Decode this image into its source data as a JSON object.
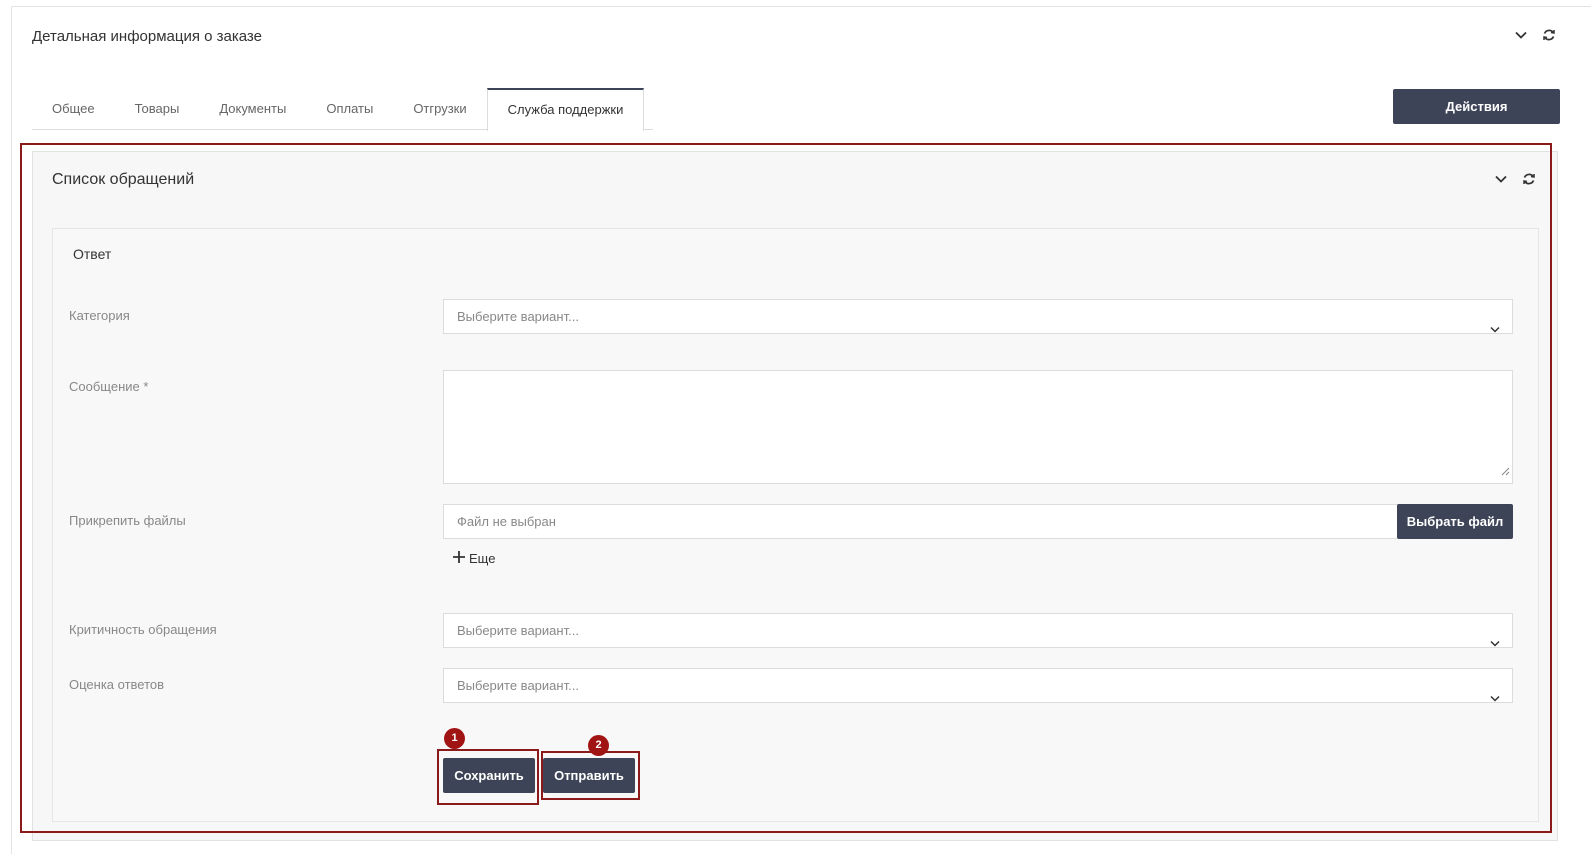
{
  "header": {
    "title": "Детальная информация о заказе",
    "icons": [
      "chevron-down-icon",
      "refresh-icon"
    ]
  },
  "tabs": [
    {
      "label": "Общее",
      "active": false
    },
    {
      "label": "Товары",
      "active": false
    },
    {
      "label": "Документы",
      "active": false
    },
    {
      "label": "Оплаты",
      "active": false
    },
    {
      "label": "Отгрузки",
      "active": false
    },
    {
      "label": "Служба поддержки",
      "active": true
    }
  ],
  "actions_label": "Действия",
  "section": {
    "title": "Список обращений",
    "icons": [
      "chevron-down-icon",
      "refresh-icon"
    ]
  },
  "form": {
    "title": "Ответ",
    "category": {
      "label": "Категория",
      "placeholder": "Выберите вариант..."
    },
    "message": {
      "label": "Сообщение *",
      "value": ""
    },
    "files": {
      "label": "Прикрепить файлы",
      "value": "Файл не выбран",
      "button": "Выбрать файл",
      "add_more": "Еще"
    },
    "criticality": {
      "label": "Критичность обращения",
      "placeholder": "Выберите вариант..."
    },
    "rating": {
      "label": "Оценка ответов",
      "placeholder": "Выберите вариант..."
    },
    "save_label": "Сохранить",
    "send_label": "Отправить"
  },
  "annotations": {
    "badge_1": "1",
    "badge_2": "2",
    "color": "#a01414"
  },
  "colors": {
    "button_dark": "#3d4457",
    "highlight": "#8b1a1a"
  }
}
